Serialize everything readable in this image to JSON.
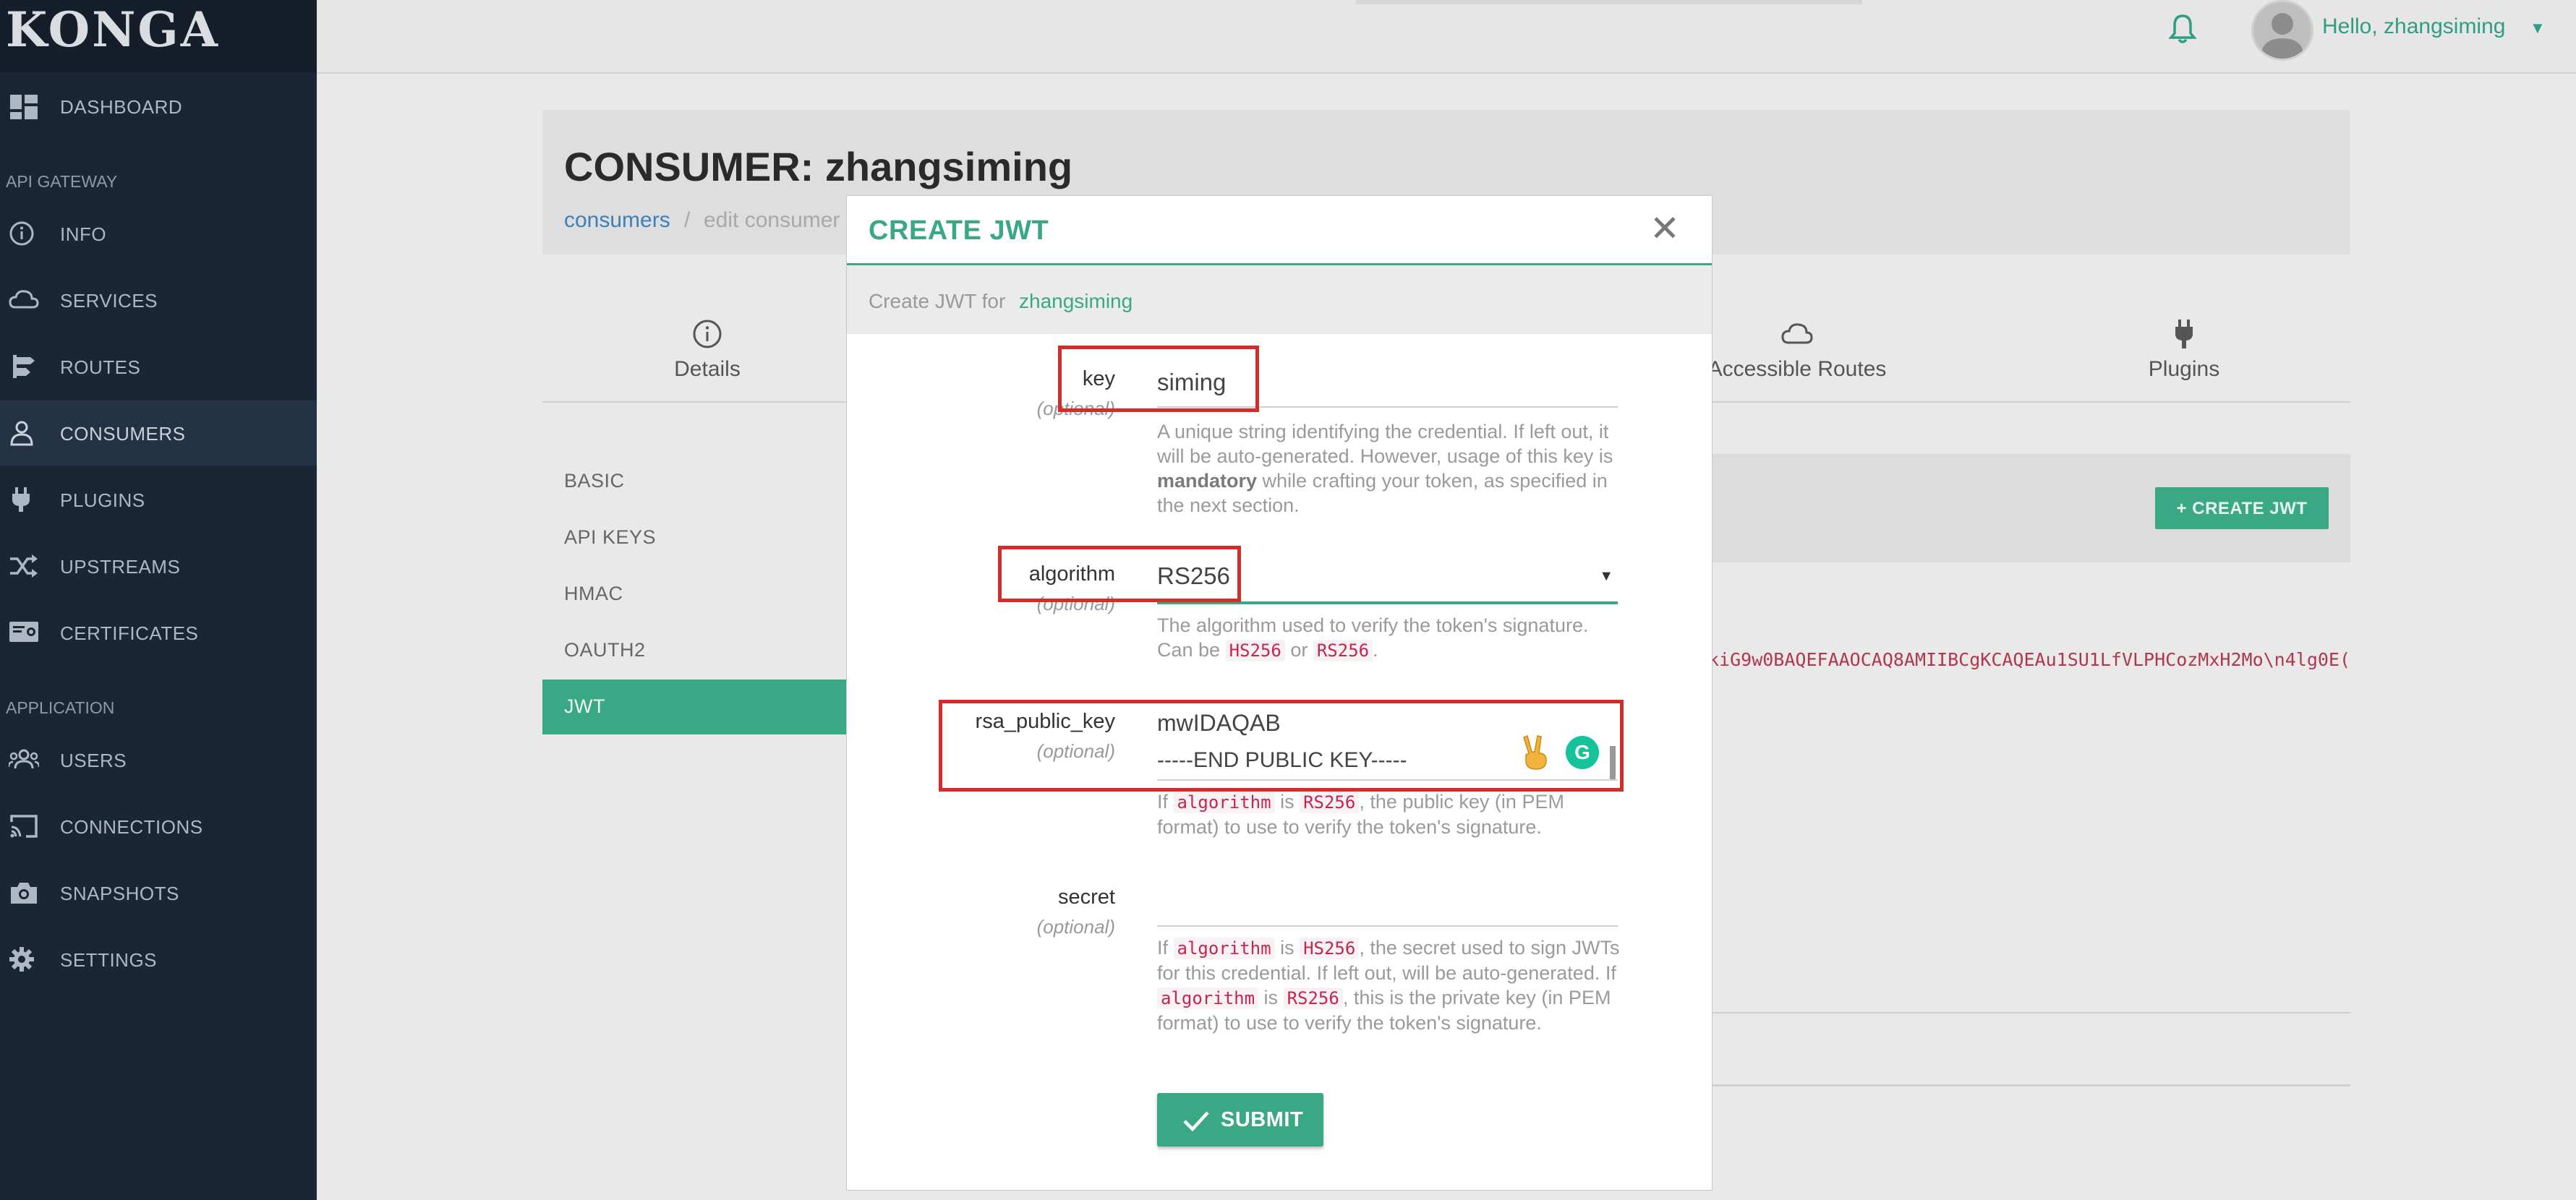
{
  "brand": "KONGA",
  "sidebar": {
    "sections": [
      "API GATEWAY",
      "APPLICATION"
    ],
    "items": [
      {
        "label": "DASHBOARD",
        "icon": "dashboard-icon"
      },
      {
        "label": "INFO",
        "icon": "info-icon"
      },
      {
        "label": "SERVICES",
        "icon": "cloud-icon"
      },
      {
        "label": "ROUTES",
        "icon": "routes-icon"
      },
      {
        "label": "CONSUMERS",
        "icon": "user-icon",
        "active": true
      },
      {
        "label": "PLUGINS",
        "icon": "plug-icon"
      },
      {
        "label": "UPSTREAMS",
        "icon": "shuffle-icon"
      },
      {
        "label": "CERTIFICATES",
        "icon": "certificate-icon"
      },
      {
        "label": "USERS",
        "icon": "users-icon"
      },
      {
        "label": "CONNECTIONS",
        "icon": "cast-icon"
      },
      {
        "label": "SNAPSHOTS",
        "icon": "camera-icon"
      },
      {
        "label": "SETTINGS",
        "icon": "gear-icon"
      }
    ]
  },
  "topbar": {
    "greeting": "Hello, zhangsiming"
  },
  "page": {
    "title": "CONSUMER: zhangsiming",
    "breadcrumb": [
      "consumers",
      "edit consumer"
    ],
    "tabs": [
      {
        "label": "Details",
        "icon": "info-icon"
      },
      {
        "label": "Accessible Routes",
        "icon": "cloud-icon"
      },
      {
        "label": "Plugins",
        "icon": "plug-icon"
      }
    ],
    "credentials": [
      "BASIC",
      "API KEYS",
      "HMAC",
      "OAUTH2",
      "JWT"
    ],
    "create_button": "+ CREATE JWT",
    "jwt_row_text": "kiG9w0BAQEFAAOCAQ8AMIIBCgKCAQEAu1SU1LfVLPHCozMxH2Mo\\n4lg0E("
  },
  "modal": {
    "title": "CREATE JWT",
    "close_glyph": "✕",
    "subtitle_prefix": "Create JWT for",
    "subtitle_name": "zhangsiming",
    "optional": "(optional)",
    "fields": {
      "key": {
        "label": "key",
        "value": "siming"
      },
      "algorithm": {
        "label": "algorithm",
        "value": "RS256"
      },
      "rsa_public_key": {
        "label": "rsa_public_key",
        "line1": "mwIDAQAB",
        "line2": "-----END PUBLIC KEY-----"
      },
      "secret": {
        "label": "secret",
        "value": ""
      }
    },
    "help": {
      "key_a": "A unique string identifying the credential. If left out, it will be auto-generated. However, usage of this key is ",
      "key_b": "mandatory",
      "key_c": " while crafting your token, as specified in the next section.",
      "alg_a": "The algorithm used to verify the token's signature. Can be ",
      "alg_or": " or ",
      "alg_end": ".",
      "rsa_a": "If ",
      "rsa_is": " is ",
      "rsa_b": ", the public key (in PEM format) to use to verify the token's signature.",
      "sec_a": "If ",
      "sec_is": " is ",
      "sec_b": ", the secret used to sign JWTs for this credential. If left out, will be auto-generated. If ",
      "sec_is2": " is ",
      "sec_c": ", this is the private key (in PEM format) to use to verify the token's signature.",
      "code_algorithm": "algorithm",
      "code_hs256": "HS256",
      "code_rs256": "RS256"
    },
    "submit_label": "SUBMIT",
    "grammarly_letter": "G",
    "emoji": "✌"
  },
  "colors": {
    "accent": "#3aa884",
    "sidebar_bg": "#1b2634",
    "highlight_box": "#d42b2b",
    "code": "#c7254e"
  }
}
